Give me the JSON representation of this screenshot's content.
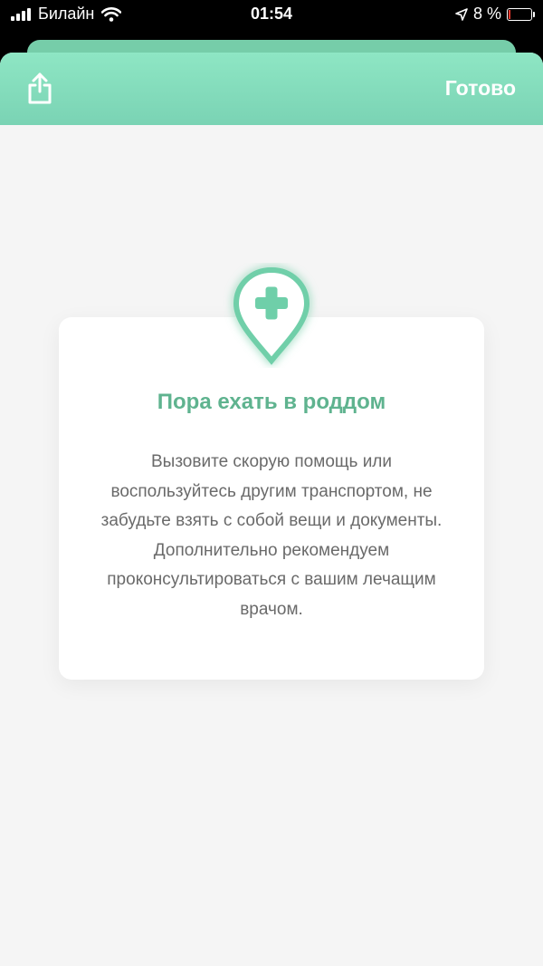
{
  "status_bar": {
    "carrier": "Билайн",
    "time": "01:54",
    "battery": "8 %"
  },
  "header": {
    "share_icon": "share-icon",
    "done_label": "Готово"
  },
  "card": {
    "icon": "hospital-pin-icon",
    "title": "Пора ехать в роддом",
    "body": "Вызовите скорую помощь или воспользуйтесь другим транспортом, не забудьте взять с собой вещи и документы. Дополнительно рекомендуем проконсультироваться с вашим лечащим врачом."
  },
  "colors": {
    "header_top": "#8ee6c4",
    "header_bottom": "#7ad3b4",
    "accent": "#5fb38f",
    "body_text": "#6a6a6a",
    "background": "#f5f5f5"
  }
}
